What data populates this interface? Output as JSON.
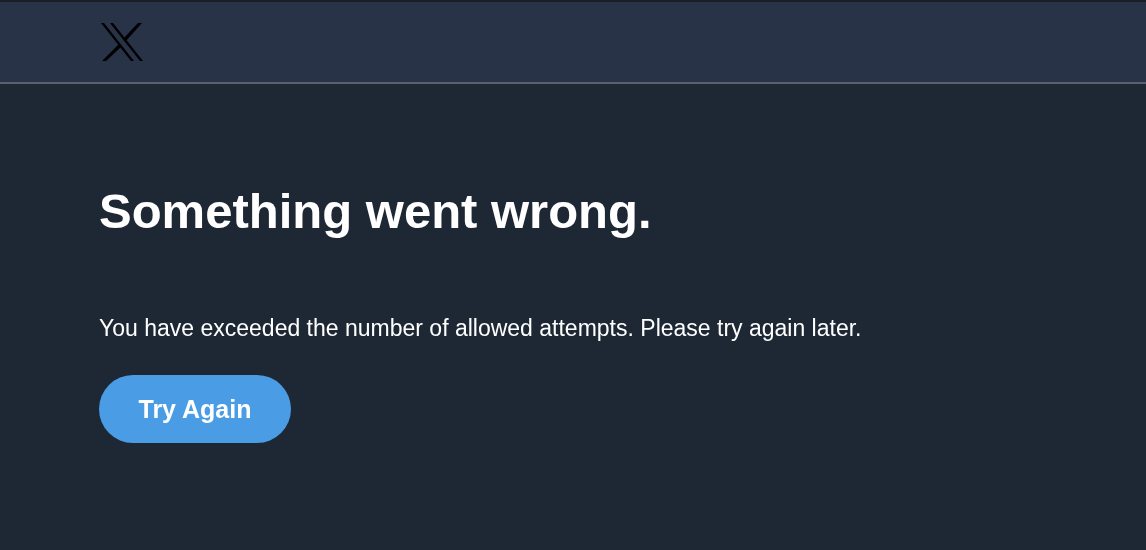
{
  "header": {
    "logo": true
  },
  "error": {
    "title": "Something went wrong.",
    "message": "You have exceeded the number of allowed attempts. Please try again later.",
    "button": "Try Again"
  }
}
